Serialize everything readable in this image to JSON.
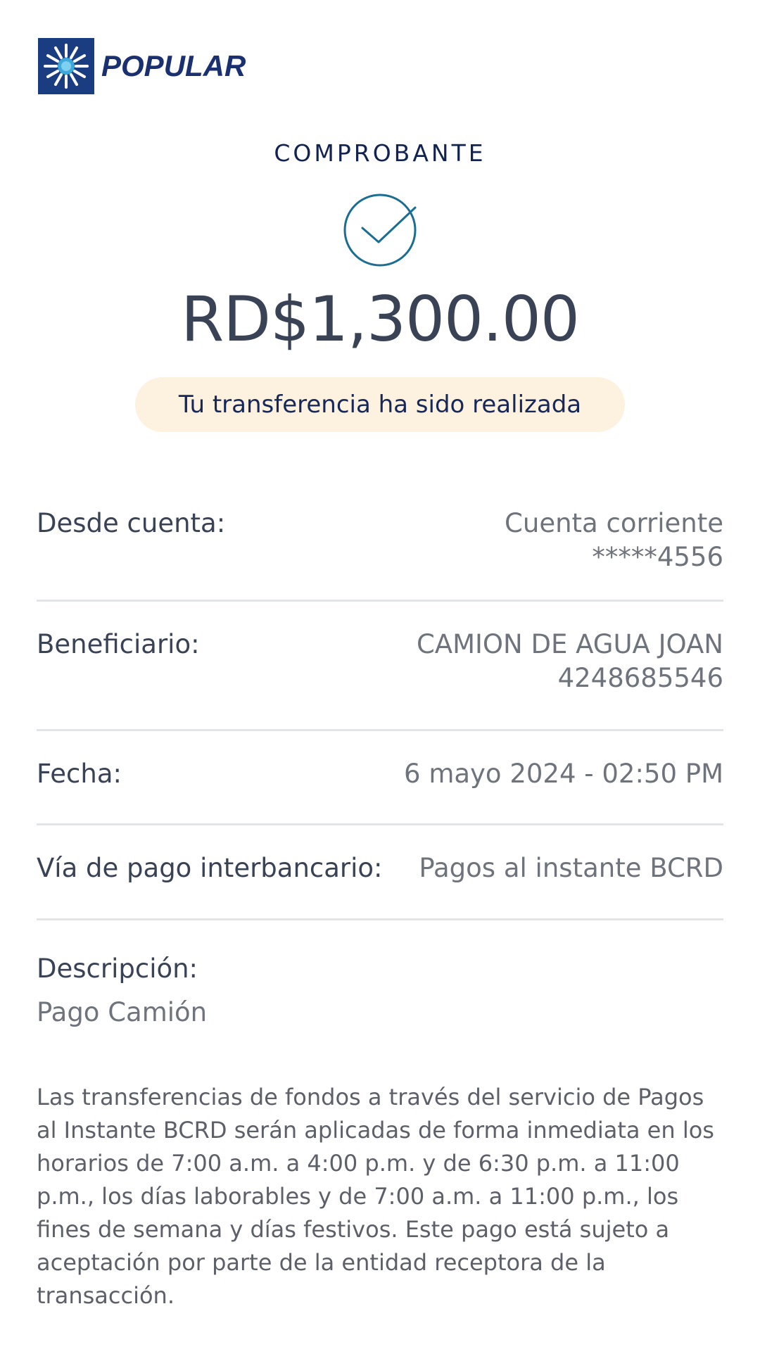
{
  "header": {
    "logo_text": "POPULAR"
  },
  "receipt": {
    "title": "COMPROBANTE",
    "check_icon": "check-circle-icon",
    "amount": "RD$1,300.00",
    "status_message": "Tu transferencia ha sido realizada"
  },
  "details": {
    "desde": {
      "label": "Desde cuenta:",
      "value_line1": "Cuenta corriente",
      "value_line2": "*****4556"
    },
    "beneficiario": {
      "label": "Beneficiario:",
      "value_line1": "CAMION DE AGUA JOAN",
      "value_line2": "4248685546"
    },
    "fecha": {
      "label": "Fecha:",
      "value": "6 mayo 2024 - 02:50 PM"
    },
    "via": {
      "label": "Vía de pago interbancario:",
      "value": "Pagos al instante BCRD"
    },
    "descripcion": {
      "label": "Descripción:",
      "value": "Pago Camión"
    }
  },
  "disclaimer": "Las transferencias de fondos a través del servicio de Pagos al Instante BCRD serán aplicadas de forma inmediata en los horarios de 7:00 a.m. a 4:00 p.m. y de 6:30 p.m. a 11:00 p.m., los días laborables y de 7:00 a.m. a 11:00 p.m., los fines de semana y días festivos. Este pago está sujeto a aceptación por parte de la entidad receptora de la transacción.",
  "colors": {
    "brand_navy": "#1a3070",
    "accent_teal": "#1b6d92",
    "pill_bg": "#fdf1df",
    "divider": "#e3e4e7"
  }
}
